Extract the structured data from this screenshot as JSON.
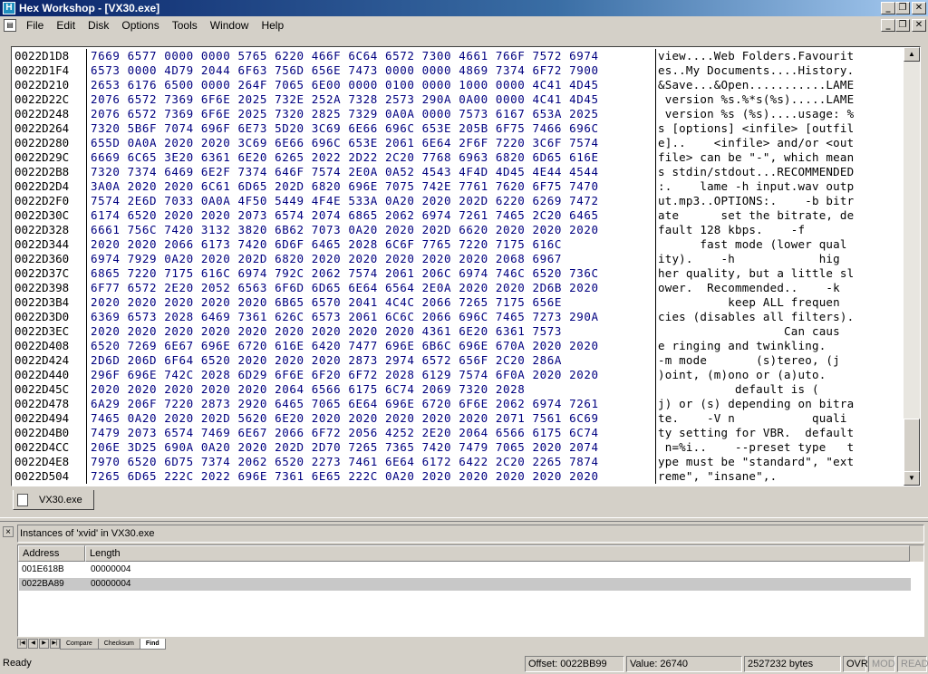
{
  "window": {
    "title": "Hex Workshop - [VX30.exe]"
  },
  "menu": [
    "File",
    "Edit",
    "Disk",
    "Options",
    "Tools",
    "Window",
    "Help"
  ],
  "hex": {
    "rows": [
      {
        "addr": "0022D1D8",
        "bytes": "7669 6577 0000 0000 5765 6220 466F 6C64 6572 7300 4661 766F 7572 6974",
        "ascii": "view....Web Folders.Favourit"
      },
      {
        "addr": "0022D1F4",
        "bytes": "6573 0000 4D79 2044 6F63 756D 656E 7473 0000 0000 4869 7374 6F72 7900",
        "ascii": "es..My Documents....History."
      },
      {
        "addr": "0022D210",
        "bytes": "2653 6176 6500 0000 264F 7065 6E00 0000 0100 0000 1000 0000 4C41 4D45",
        "ascii": "&Save...&Open...........LAME"
      },
      {
        "addr": "0022D22C",
        "bytes": "2076 6572 7369 6F6E 2025 732E 252A 7328 2573 290A 0A00 0000 4C41 4D45",
        "ascii": " version %s.%*s(%s).....LAME"
      },
      {
        "addr": "0022D248",
        "bytes": "2076 6572 7369 6F6E 2025 7320 2825 7329 0A0A 0000 7573 6167 653A 2025",
        "ascii": " version %s (%s)....usage: %"
      },
      {
        "addr": "0022D264",
        "bytes": "7320 5B6F 7074 696F 6E73 5D20 3C69 6E66 696C 653E 205B 6F75 7466 696C",
        "ascii": "s [options] <infile> [outfil"
      },
      {
        "addr": "0022D280",
        "bytes": "655D 0A0A 2020 2020 3C69 6E66 696C 653E 2061 6E64 2F6F 7220 3C6F 7574",
        "ascii": "e]..    <infile> and/or <out"
      },
      {
        "addr": "0022D29C",
        "bytes": "6669 6C65 3E20 6361 6E20 6265 2022 2D22 2C20 7768 6963 6820 6D65 616E",
        "ascii": "file> can be \"-\", which mean"
      },
      {
        "addr": "0022D2B8",
        "bytes": "7320 7374 6469 6E2F 7374 646F 7574 2E0A 0A52 4543 4F4D 4D45 4E44 4544",
        "ascii": "s stdin/stdout...RECOMMENDED"
      },
      {
        "addr": "0022D2D4",
        "bytes": "3A0A 2020 2020 6C61 6D65 202D 6820 696E 7075 742E 7761 7620 6F75 7470",
        "ascii": ":.    lame -h input.wav outp"
      },
      {
        "addr": "0022D2F0",
        "bytes": "7574 2E6D 7033 0A0A 4F50 5449 4F4E 533A 0A20 2020 202D 6220 6269 7472",
        "ascii": "ut.mp3..OPTIONS:.    -b bitr"
      },
      {
        "addr": "0022D30C",
        "bytes": "6174 6520 2020 2020 2073 6574 2074 6865 2062 6974 7261 7465 2C20 6465",
        "ascii": "ate      set the bitrate, de"
      },
      {
        "addr": "0022D328",
        "bytes": "6661 756C 7420 3132 3820 6B62 7073 0A20 2020 202D 6620 2020 2020 2020",
        "ascii": "fault 128 kbps.    -f       "
      },
      {
        "addr": "0022D344",
        "bytes": "2020 2020 2066 6173 7420 6D6F 6465 2028 6C6F 7765 7220 7175 616C",
        "ascii": "      fast mode (lower qual"
      },
      {
        "addr": "0022D360",
        "bytes": "6974 7929 0A20 2020 202D 6820 2020 2020 2020 2020 2020 2068 6967",
        "ascii": "ity).    -h            hig"
      },
      {
        "addr": "0022D37C",
        "bytes": "6865 7220 7175 616C 6974 792C 2062 7574 2061 206C 6974 746C 6520 736C",
        "ascii": "her quality, but a little sl"
      },
      {
        "addr": "0022D398",
        "bytes": "6F77 6572 2E20 2052 6563 6F6D 6D65 6E64 6564 2E0A 2020 2020 2D6B 2020",
        "ascii": "ower.  Recommended..    -k  "
      },
      {
        "addr": "0022D3B4",
        "bytes": "2020 2020 2020 2020 2020 6B65 6570 2041 4C4C 2066 7265 7175 656E",
        "ascii": "          keep ALL frequen"
      },
      {
        "addr": "0022D3D0",
        "bytes": "6369 6573 2028 6469 7361 626C 6573 2061 6C6C 2066 696C 7465 7273 290A",
        "ascii": "cies (disables all filters)."
      },
      {
        "addr": "0022D3EC",
        "bytes": "2020 2020 2020 2020 2020 2020 2020 2020 2020 4361 6E20 6361 7573",
        "ascii": "                  Can caus"
      },
      {
        "addr": "0022D408",
        "bytes": "6520 7269 6E67 696E 6720 616E 6420 7477 696E 6B6C 696E 670A 2020 2020",
        "ascii": "e ringing and twinkling.    "
      },
      {
        "addr": "0022D424",
        "bytes": "2D6D 206D 6F64 6520 2020 2020 2020 2873 2974 6572 656F 2C20 286A",
        "ascii": "-m mode       (s)tereo, (j"
      },
      {
        "addr": "0022D440",
        "bytes": "296F 696E 742C 2028 6D29 6F6E 6F20 6F72 2028 6129 7574 6F0A 2020 2020",
        "ascii": ")oint, (m)ono or (a)uto.    "
      },
      {
        "addr": "0022D45C",
        "bytes": "2020 2020 2020 2020 2020 2064 6566 6175 6C74 2069 7320 2028",
        "ascii": "           default is ("
      },
      {
        "addr": "0022D478",
        "bytes": "6A29 206F 7220 2873 2920 6465 7065 6E64 696E 6720 6F6E 2062 6974 7261",
        "ascii": "j) or (s) depending on bitra"
      },
      {
        "addr": "0022D494",
        "bytes": "7465 0A20 2020 202D 5620 6E20 2020 2020 2020 2020 2020 2071 7561 6C69",
        "ascii": "te.    -V n           quali"
      },
      {
        "addr": "0022D4B0",
        "bytes": "7479 2073 6574 7469 6E67 2066 6F72 2056 4252 2E20 2064 6566 6175 6C74",
        "ascii": "ty setting for VBR.  default"
      },
      {
        "addr": "0022D4CC",
        "bytes": "206E 3D25 690A 0A20 2020 202D 2D70 7265 7365 7420 7479 7065 2020 2074",
        "ascii": " n=%i..    --preset type   t"
      },
      {
        "addr": "0022D4E8",
        "bytes": "7970 6520 6D75 7374 2062 6520 2273 7461 6E64 6172 6422 2C20 2265 7874",
        "ascii": "ype must be \"standard\", \"ext"
      },
      {
        "addr": "0022D504",
        "bytes": "7265 6D65 222C 2022 696E 7361 6E65 222C 0A20 2020 2020 2020 2020 2020",
        "ascii": "reme\", \"insane\",.          "
      }
    ]
  },
  "document_tab": {
    "label": "VX30.exe"
  },
  "find_panel": {
    "title": "Instances of 'xvid' in VX30.exe",
    "columns": [
      "Address",
      "Length"
    ],
    "rows": [
      {
        "address": "001E618B",
        "length": "00000004"
      },
      {
        "address": "0022BA89",
        "length": "00000004"
      }
    ],
    "tabs": [
      "Compare",
      "Checksum",
      "Find"
    ]
  },
  "status": {
    "ready": "Ready",
    "offset": "Offset: 0022BB99",
    "value": "Value: 26740",
    "size": "2527232 bytes",
    "ovr": "OVR",
    "mod": "MOD",
    "read": "READ"
  }
}
